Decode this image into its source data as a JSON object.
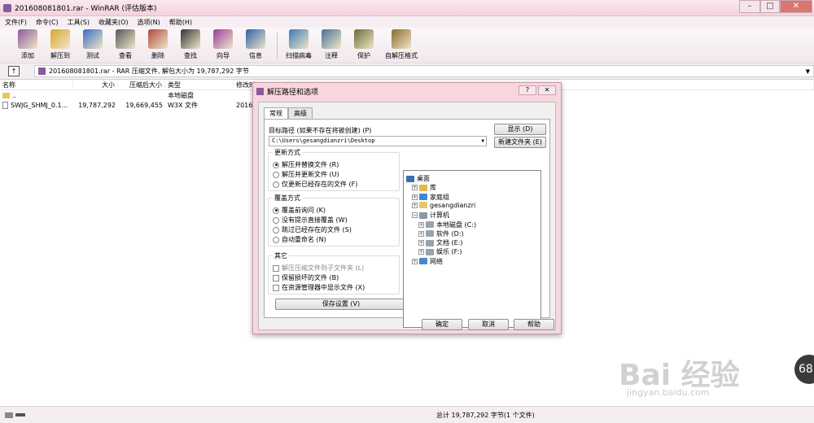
{
  "window": {
    "title": "201608081801.rar - WinRAR (评估版本)"
  },
  "menu": [
    "文件(F)",
    "命令(C)",
    "工具(S)",
    "收藏夹(O)",
    "选项(N)",
    "帮助(H)"
  ],
  "toolbar": [
    {
      "label": "添加",
      "icon": "add-icon",
      "color": "#8a5a9e"
    },
    {
      "label": "解压到",
      "icon": "extract-to-icon",
      "color": "#d9a530"
    },
    {
      "label": "测试",
      "icon": "test-icon",
      "color": "#3b6cc4"
    },
    {
      "label": "查看",
      "icon": "view-icon",
      "color": "#555555"
    },
    {
      "label": "删除",
      "icon": "delete-icon",
      "color": "#b0473e"
    },
    {
      "label": "查找",
      "icon": "find-icon",
      "color": "#333333"
    },
    {
      "label": "向导",
      "icon": "wizard-icon",
      "color": "#9a3d9a"
    },
    {
      "label": "信息",
      "icon": "info-icon",
      "color": "#2d5fa8"
    },
    {
      "label": "扫描病毒",
      "icon": "scan-virus-icon",
      "color": "#3c7ab8"
    },
    {
      "label": "注释",
      "icon": "comment-icon",
      "color": "#4a6f9a"
    },
    {
      "label": "保护",
      "icon": "protect-icon",
      "color": "#6b6b3a"
    },
    {
      "label": "自解压格式",
      "icon": "sfx-icon",
      "color": "#8c6a2e"
    }
  ],
  "address": "201608081801.rar - RAR 压缩文件, 解包大小为 19,787,292 字节",
  "columns": [
    "名称",
    "大小",
    "压缩后大小",
    "类型",
    "修改时"
  ],
  "files": [
    {
      "name": "..",
      "size": "",
      "packed": "",
      "type": "本地磁盘",
      "modified": ""
    },
    {
      "name": "SWJG_SHMJ_0.1...",
      "size": "19,787,292",
      "packed": "19,669,455",
      "type": "W3X 文件",
      "modified": "2016/"
    }
  ],
  "status": {
    "total": "总计 19,787,292 字节(1 个文件)"
  },
  "dialog": {
    "title": "解压路径和选项",
    "help_q": "?",
    "close": "✕",
    "tabs": [
      "常规",
      "高级"
    ],
    "target_label": "目标路径 (如果不存在将被创建) (P)",
    "target_value": "C:\\Users\\gesangdianzri\\Desktop",
    "show_btn": "显示 (D)",
    "new_folder_btn": "新建文件夹 (E)",
    "update_title": "更新方式",
    "update_opts": [
      "解压并替换文件 (R)",
      "解压并更新文件 (U)",
      "仅更新已经存在的文件 (F)"
    ],
    "overwrite_title": "覆盖方式",
    "overwrite_opts": [
      "覆盖前询问 (K)",
      "没有提示直接覆盖 (W)",
      "跳过已经存在的文件 (S)",
      "自动重命名 (N)"
    ],
    "other_title": "其它",
    "other_opts": [
      "解压压缩文件到子文件夹 (L)",
      "保留损坏的文件 (B)",
      "在资源管理器中显示文件 (X)"
    ],
    "save_btn": "保存设置 (V)",
    "tree": [
      {
        "label": "桌面",
        "exp": "",
        "icon": "desktop-icon",
        "color": "#3a6fb5"
      },
      {
        "label": "库",
        "exp": "+",
        "icon": "library-icon",
        "color": "#e0b84a"
      },
      {
        "label": "家庭组",
        "exp": "+",
        "icon": "homegroup-icon",
        "color": "#3c8ad6"
      },
      {
        "label": "gesangdianzri",
        "exp": "+",
        "icon": "user-folder-icon",
        "color": "#e6c66a"
      },
      {
        "label": "计算机",
        "exp": "−",
        "icon": "computer-icon",
        "color": "#8a98a8"
      },
      {
        "label": "本地磁盘 (C:)",
        "exp": "+",
        "icon": "drive-c-icon",
        "color": "#9aa2ad"
      },
      {
        "label": "软件 (D:)",
        "exp": "+",
        "icon": "drive-d-icon",
        "color": "#9aa2ad"
      },
      {
        "label": "文档 (E:)",
        "exp": "+",
        "icon": "drive-e-icon",
        "color": "#9aa2ad"
      },
      {
        "label": "娱乐 (F:)",
        "exp": "+",
        "icon": "drive-f-icon",
        "color": "#9aa2ad"
      },
      {
        "label": "网络",
        "exp": "+",
        "icon": "network-icon",
        "color": "#4a86c8"
      }
    ],
    "ok": "确定",
    "cancel": "取消",
    "help": "帮助"
  },
  "watermark": {
    "brand": "Bai 经验",
    "url": "jingyan.baidu.com",
    "badge": "68"
  }
}
